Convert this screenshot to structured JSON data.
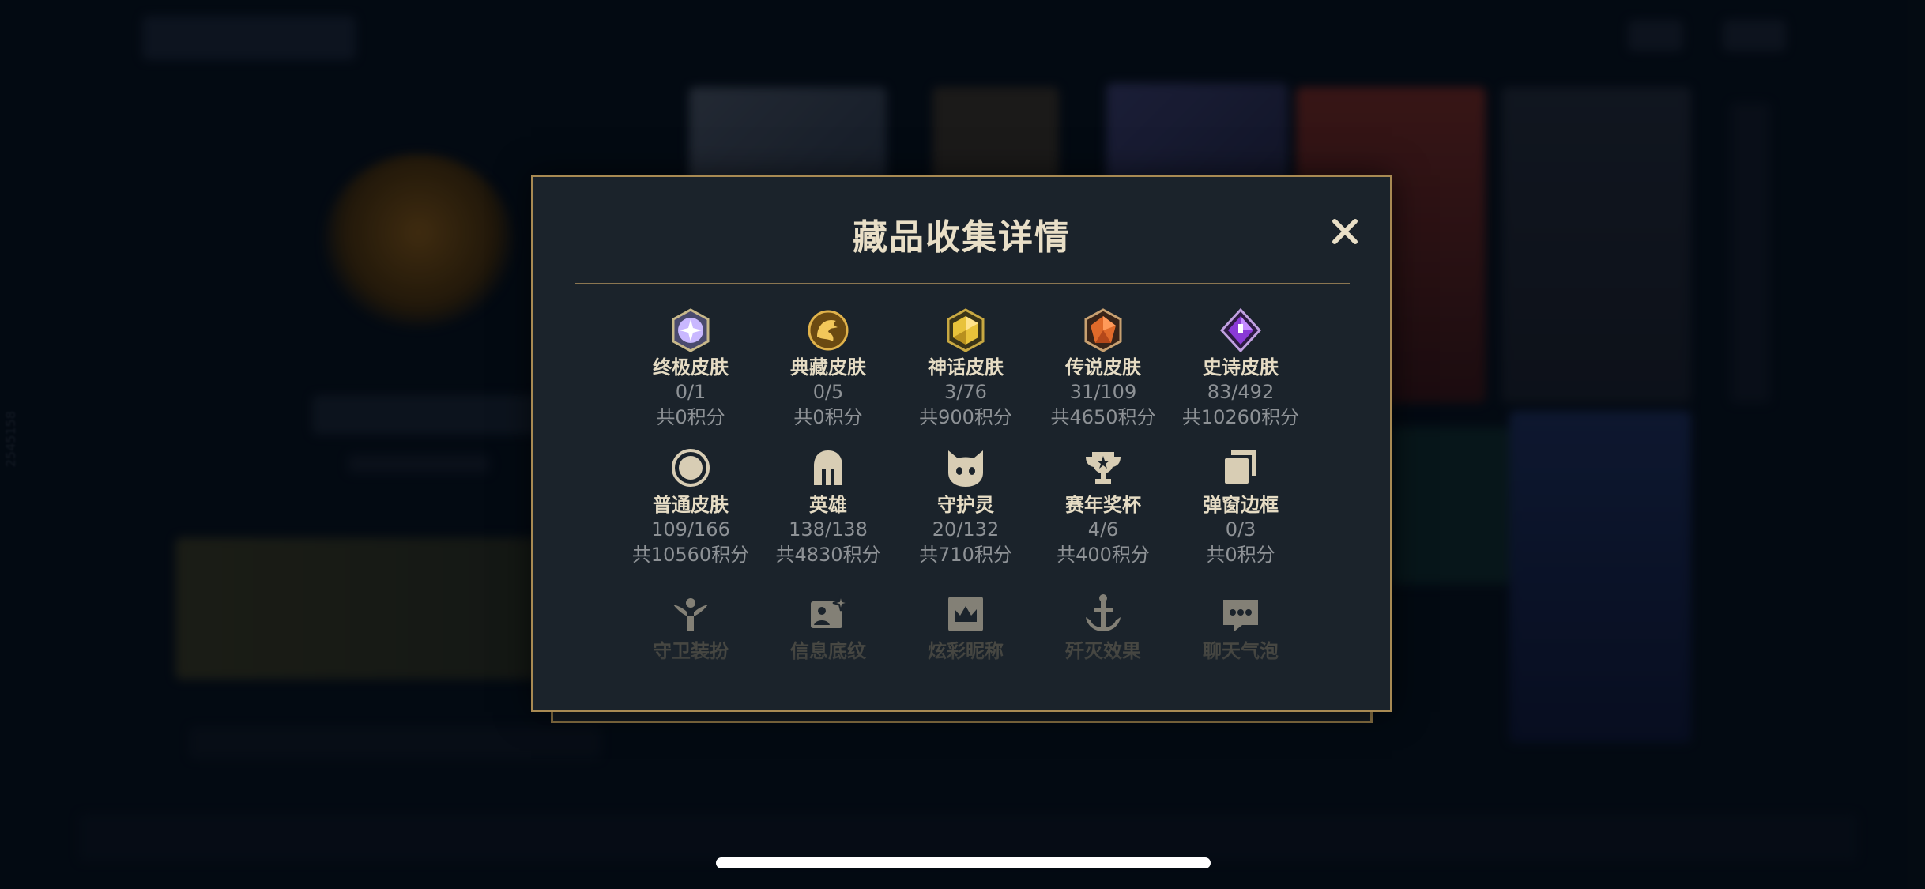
{
  "background": {
    "side_id": "2545158"
  },
  "modal": {
    "title": "藏品收集详情",
    "close_icon": "close-icon",
    "items": [
      {
        "name": "终极皮肤",
        "count": "0/1",
        "points": "共0积分",
        "icon": "ultimate-gem-icon",
        "color": "#b8a6f0"
      },
      {
        "name": "典藏皮肤",
        "count": "0/5",
        "points": "共0积分",
        "icon": "dragon-emblem-icon",
        "color": "#d6a43a"
      },
      {
        "name": "神话皮肤",
        "count": "3/76",
        "points": "共900积分",
        "icon": "mythic-gem-icon",
        "color": "#e8c23a"
      },
      {
        "name": "传说皮肤",
        "count": "31/109",
        "points": "共4650积分",
        "icon": "legendary-gem-icon",
        "color": "#e06a2a"
      },
      {
        "name": "史诗皮肤",
        "count": "83/492",
        "points": "共10260积分",
        "icon": "epic-gem-icon",
        "color": "#8a3ad6"
      },
      {
        "name": "普通皮肤",
        "count": "109/166",
        "points": "共10560积分",
        "icon": "circle-icon",
        "color": "#d8cdb4"
      },
      {
        "name": "英雄",
        "count": "138/138",
        "points": "共4830积分",
        "icon": "helmet-icon",
        "color": "#d8cdb4"
      },
      {
        "name": "守护灵",
        "count": "20/132",
        "points": "共710积分",
        "icon": "cat-face-icon",
        "color": "#d8cdb4"
      },
      {
        "name": "赛年奖杯",
        "count": "4/6",
        "points": "共400积分",
        "icon": "trophy-icon",
        "color": "#d8cdb4"
      },
      {
        "name": "弹窗边框",
        "count": "0/3",
        "points": "共0积分",
        "icon": "frame-stack-icon",
        "color": "#d8cdb4"
      },
      {
        "name": "守卫装扮",
        "icon": "ward-icon",
        "color": "#d8cdb4"
      },
      {
        "name": "信息底纹",
        "icon": "card-sparkle-icon",
        "color": "#d8cdb4"
      },
      {
        "name": "炫彩昵称",
        "icon": "crown-card-icon",
        "color": "#d8cdb4"
      },
      {
        "name": "歼灭效果",
        "icon": "anchor-icon",
        "color": "#d8cdb4"
      },
      {
        "name": "聊天气泡",
        "icon": "chat-bubble-icon",
        "color": "#d8cdb4"
      }
    ]
  }
}
